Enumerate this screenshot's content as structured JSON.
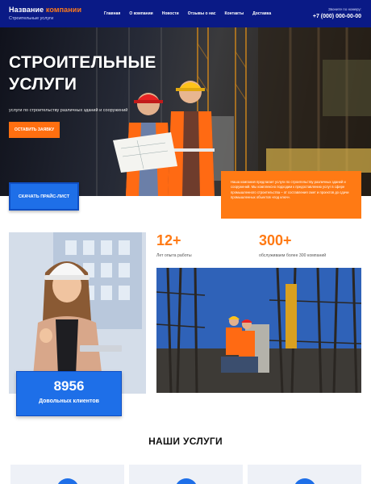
{
  "header": {
    "logo_main": "Название",
    "logo_accent": "компании",
    "logo_sub": "Строительные услуги",
    "nav": [
      "Главная",
      "О компании",
      "Новости",
      "Отзывы о нас",
      "Контакты",
      "Доставка"
    ],
    "call_label": "Звоните по номеру:",
    "phone": "+7 (000) 000-00-00"
  },
  "hero": {
    "title_line1": "СТРОИТЕЛЬНЫЕ",
    "title_line2": "УСЛУГИ",
    "subtitle": "услуги по строительству различных зданий и сооружений",
    "order_button": "ОСТАВИТЬ ЗАЯВКУ",
    "info_text": "Наша компания предлагает услуги по строительству различных зданий и сооружений. Мы комплексно подходим к предоставлению услуг в сфере промышленного строительства – от составления смет и проектов до сдачи промышленных объектов «под ключ».",
    "price_button": "СКАЧАТЬ ПРАЙС-ЛИСТ"
  },
  "stats": {
    "experience_num": "12+",
    "experience_label": "Лет опыта работы",
    "companies_num": "300+",
    "companies_label": "обслуживаем более 300 компаний",
    "clients_num": "8956",
    "clients_label": "Довольных клиентов"
  },
  "services": {
    "title": "НАШИ УСЛУГИ"
  },
  "colors": {
    "header_bg": "#0a1a86",
    "accent": "#ff7a14",
    "blue": "#1e6fe8"
  }
}
